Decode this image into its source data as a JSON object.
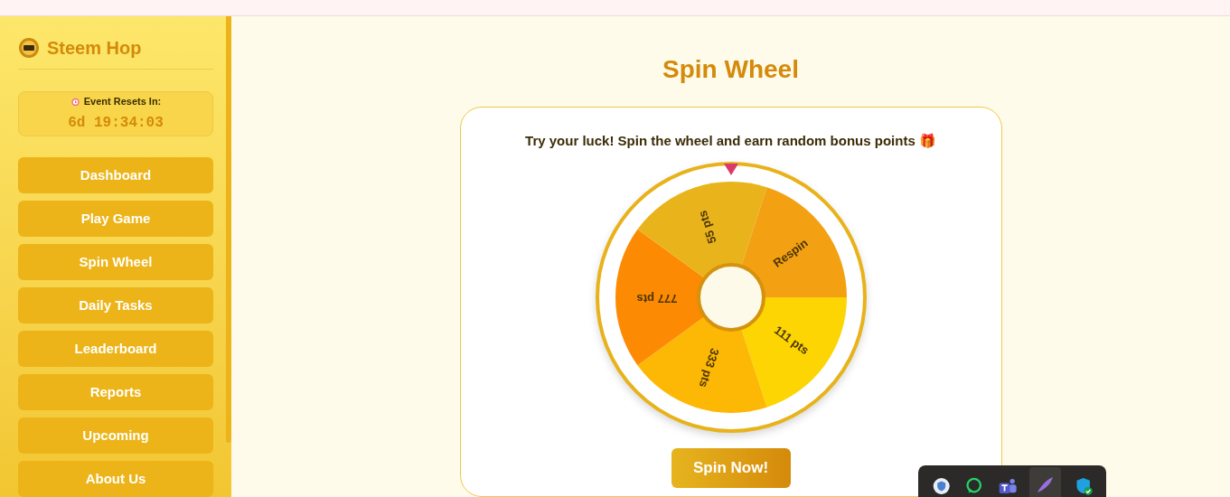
{
  "sidebar": {
    "brand": "Steem Hop",
    "timer": {
      "label": "Event Resets In:",
      "value": "6d 19:34:03"
    },
    "items": [
      {
        "label": "Dashboard",
        "selected": false
      },
      {
        "label": "Play Game",
        "selected": false
      },
      {
        "label": "Spin Wheel",
        "selected": false
      },
      {
        "label": "Daily Tasks",
        "selected": false
      },
      {
        "label": "Leaderboard",
        "selected": false
      },
      {
        "label": "Reports",
        "selected": false
      },
      {
        "label": "Upcoming",
        "selected": false
      },
      {
        "label": "About Us",
        "selected": false
      }
    ]
  },
  "main": {
    "title": "Spin Wheel",
    "prompt": "Try your luck! Spin the wheel and earn random bonus points 🎁",
    "wheel": {
      "segments": [
        {
          "label": "111 pts",
          "color": "#fcd503"
        },
        {
          "label": "333 pts",
          "color": "#fdb705"
        },
        {
          "label": "777 pts",
          "color": "#fd8a03"
        },
        {
          "label": "55 pts",
          "color": "#e9b31b"
        },
        {
          "label": "Respin",
          "color": "#f3a012"
        }
      ]
    },
    "button": "Spin Now!"
  }
}
